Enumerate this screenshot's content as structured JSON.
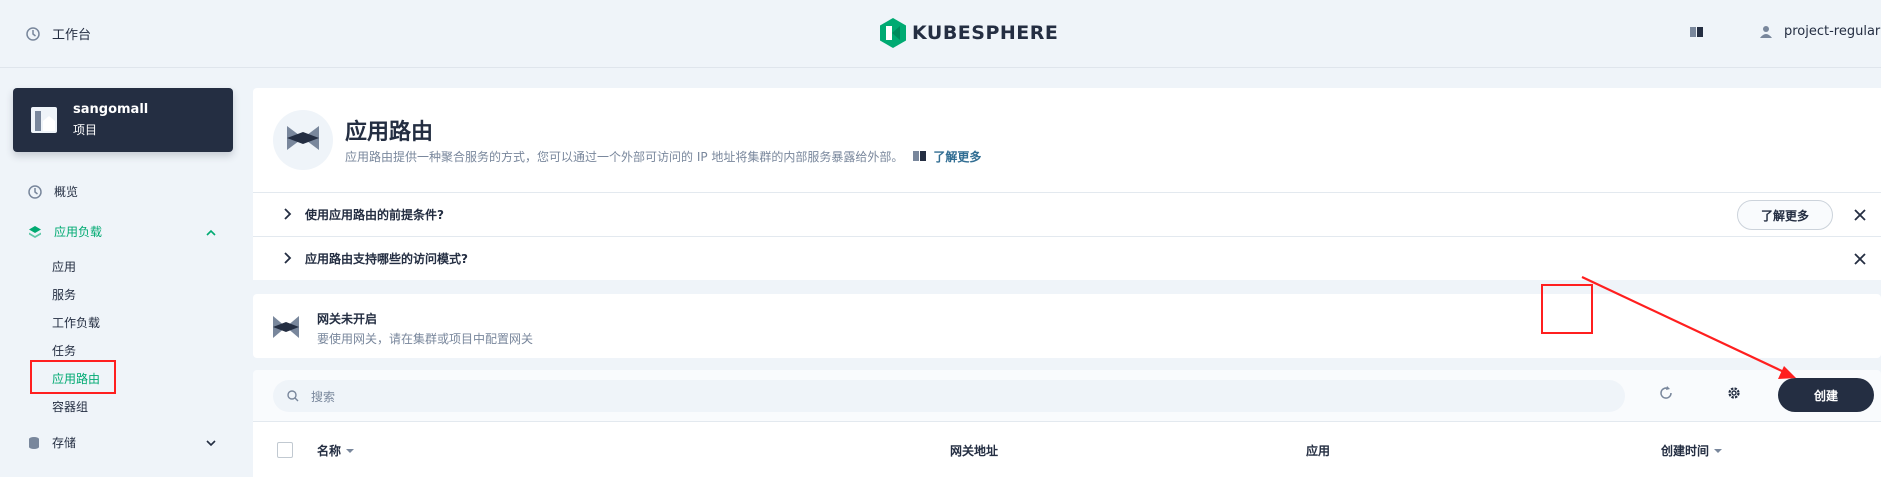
{
  "topbar": {
    "workbench_label": "工作台",
    "brand": "KUBESPHERE",
    "username": "project-regular"
  },
  "sidebar": {
    "project_name": "sangomall",
    "project_type": "项目",
    "overview": "概览",
    "workloads_group": "应用负载",
    "items": [
      "应用",
      "服务",
      "工作负载",
      "任务",
      "应用路由",
      "容器组"
    ],
    "storage": "存储"
  },
  "banner": {
    "title": "应用路由",
    "description": "应用路由提供一种聚合服务的方式，您可以通过一个外部可访问的 IP 地址将集群的内部服务暴露给外部。",
    "learn_more": "了解更多"
  },
  "tips": [
    {
      "text": "使用应用路由的前提条件?",
      "button": "了解更多"
    },
    {
      "text": "应用路由支持哪些的访问模式?"
    }
  ],
  "gateway": {
    "title": "网关未开启",
    "description": "要使用网关，请在集群或项目中配置网关"
  },
  "toolbar": {
    "search_placeholder": "搜索",
    "create_label": "创建"
  },
  "table": {
    "columns": [
      "名称",
      "网关地址",
      "应用",
      "创建时间"
    ]
  },
  "colors": {
    "accent_green": "#00aa72",
    "dark": "#242e42",
    "annotation_red": "#ff1f1f"
  }
}
